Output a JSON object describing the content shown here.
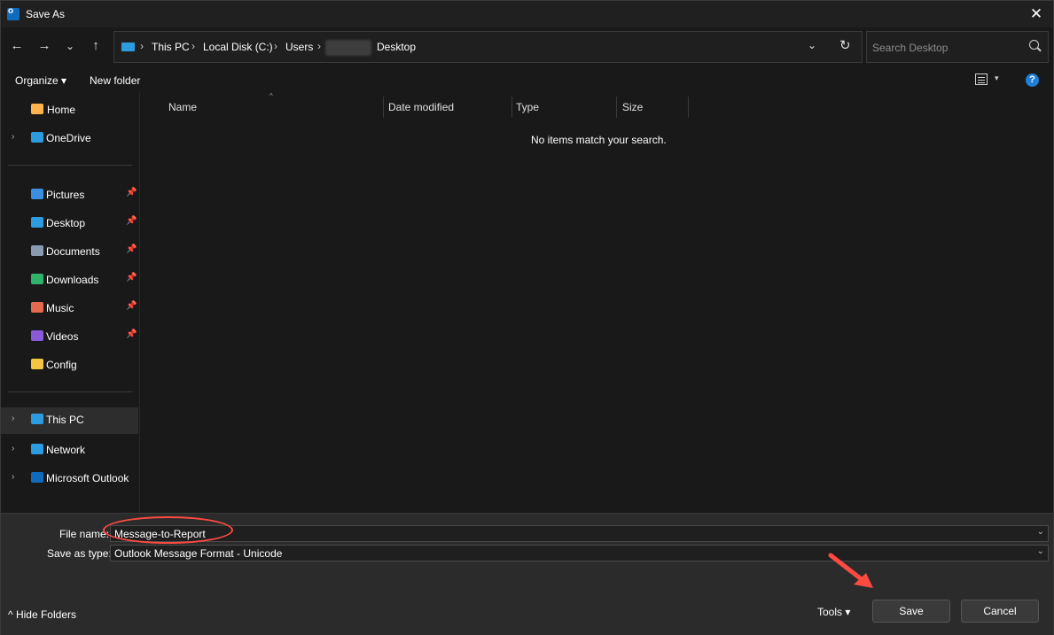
{
  "window": {
    "title": "Save As",
    "close_glyph": "✕"
  },
  "nav_buttons": {
    "back": "←",
    "forward": "→",
    "recent": "⌄",
    "up": "↑"
  },
  "address": {
    "crumbs": [
      "This PC",
      "Local Disk (C:)",
      "Users",
      "Desktop"
    ],
    "separator": "›",
    "dropdown": "⌄",
    "refresh": "↻"
  },
  "search": {
    "placeholder": "Search Desktop"
  },
  "toolbar": {
    "organize": "Organize ▾",
    "new_folder": "New folder",
    "view_dd": "▾",
    "help": "?"
  },
  "nav": {
    "items": [
      {
        "label": "Home",
        "icon": "home-icon",
        "color": "#ffb34d"
      },
      {
        "label": "OneDrive",
        "icon": "onedrive-icon",
        "color": "#2d9be0"
      },
      {
        "label": "Pictures",
        "icon": "pictures-icon",
        "color": "#3a8fe0"
      },
      {
        "label": "Desktop",
        "icon": "desktop-icon",
        "color": "#2d9be0"
      },
      {
        "label": "Documents",
        "icon": "documents-icon",
        "color": "#8a9bb0"
      },
      {
        "label": "Downloads",
        "icon": "downloads-icon",
        "color": "#2fb36b"
      },
      {
        "label": "Music",
        "icon": "music-icon",
        "color": "#e46a4f"
      },
      {
        "label": "Videos",
        "icon": "videos-icon",
        "color": "#8a5ad8"
      },
      {
        "label": "Config",
        "icon": "folder-icon",
        "color": "#f5c542"
      },
      {
        "label": "This PC",
        "icon": "this-pc-icon",
        "color": "#2d9be0"
      },
      {
        "label": "Network",
        "icon": "network-icon",
        "color": "#2d9be0"
      },
      {
        "label": "Microsoft Outlook",
        "icon": "outlook-icon",
        "color": "#0f6cbd"
      }
    ],
    "chevron": "›",
    "pin": "📌"
  },
  "columns": [
    "Name",
    "Date modified",
    "Type",
    "Size"
  ],
  "sort_glyph": "^",
  "empty_message": "No items match your search.",
  "form": {
    "file_name_label": "File name:",
    "file_name_value": "Message-to-Report",
    "type_label": "Save as type:",
    "type_value": "Outlook Message Format - Unicode",
    "dropdown_glyph": "⌄"
  },
  "footer": {
    "hide_folders": "^ Hide Folders",
    "tools": "Tools  ▾",
    "save": "Save",
    "cancel": "Cancel"
  },
  "annotation_color": "#ff4a42"
}
